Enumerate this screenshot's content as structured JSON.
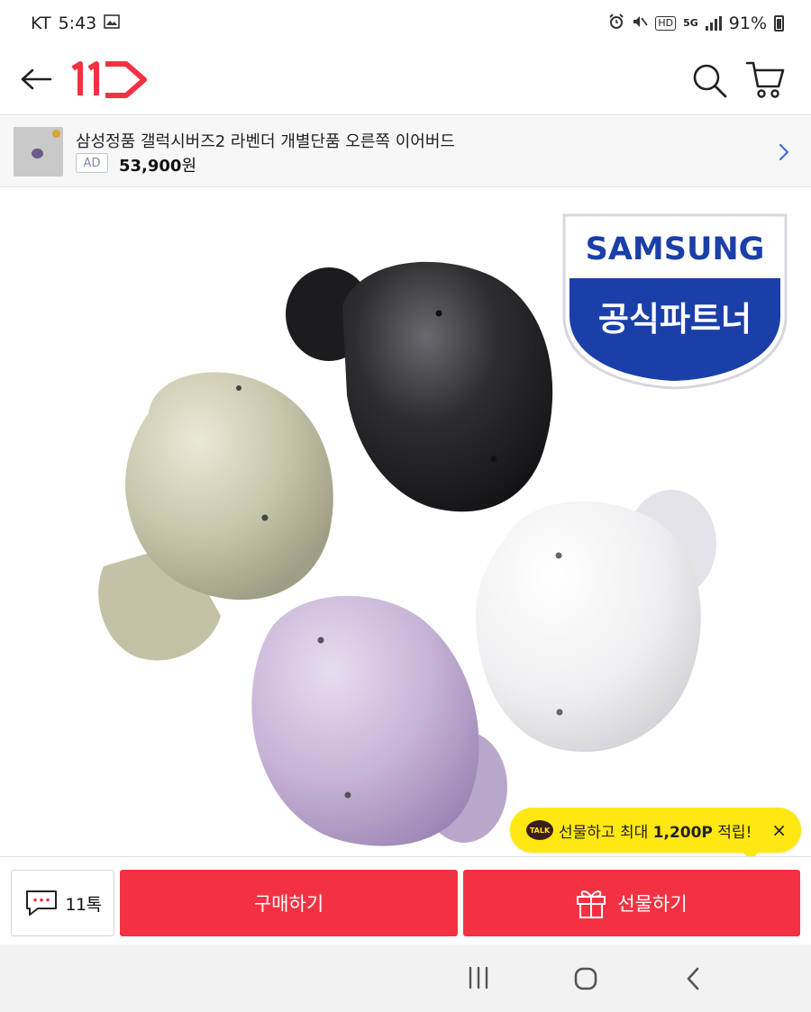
{
  "status_bar": {
    "carrier": "KT",
    "time": "5:43",
    "hd_label": "HD",
    "network": "5G",
    "battery": "91%"
  },
  "header": {
    "logo_text": "11"
  },
  "ad_banner": {
    "title": "삼성정품 갤럭시버즈2 라벤더 개별단품 오른쪽 이어버드",
    "ad_label": "AD",
    "price": "53,900",
    "price_unit": "원"
  },
  "badge": {
    "brand": "SAMSUNG",
    "subtitle": "공식파트너"
  },
  "talk_tooltip": {
    "logo_text": "TALK",
    "text_before": "선물하고 최대 ",
    "text_bold": "1,200P",
    "text_after": " 적립!",
    "close": "×"
  },
  "action_bar": {
    "chat_label": "11톡",
    "buy_label": "구매하기",
    "gift_label": "선물하기"
  },
  "colors": {
    "brand_red": "#f43142",
    "kakao_yellow": "#ffe812",
    "samsung_blue": "#1a3fa8"
  }
}
